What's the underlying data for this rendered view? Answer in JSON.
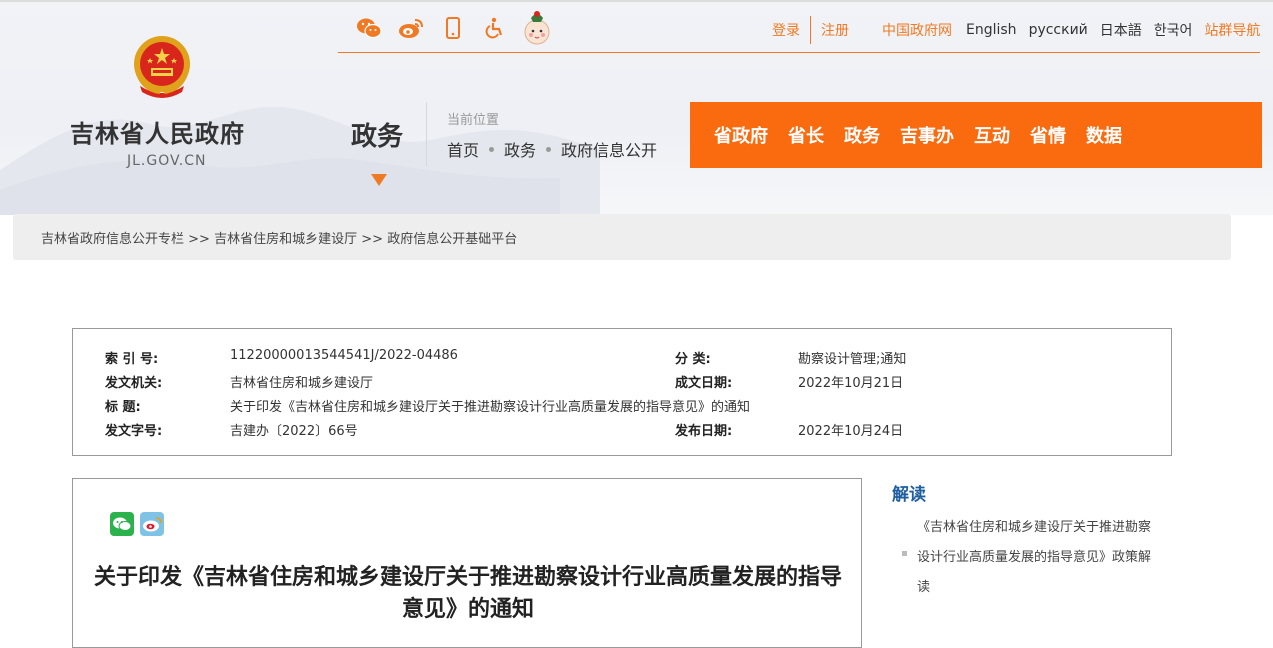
{
  "header": {
    "site_title": "吉林省人民政府",
    "site_domain": "JL.GOV.CN",
    "icons": [
      "wechat-icon",
      "weibo-icon",
      "mobile-icon",
      "accessibility-icon",
      "mascot-icon"
    ],
    "login": "登录",
    "register": "注册",
    "links": [
      "中国政府网",
      "English",
      "русский",
      "日本語",
      "한국어",
      "站群导航"
    ]
  },
  "section": {
    "label": "政务",
    "location_caption": "当前位置",
    "breadcrumb": [
      "首页",
      "政务",
      "政府信息公开"
    ]
  },
  "nav": {
    "items": [
      "省政府",
      "省长",
      "政务",
      "吉事办",
      "互动",
      "省情",
      "数据"
    ]
  },
  "strip": {
    "items": [
      "吉林省政府信息公开专栏",
      "吉林省住房和城乡建设厅",
      "政府信息公开基础平台"
    ],
    "separator": ">>"
  },
  "meta": {
    "index_label": "索 引 号:",
    "index_value": "11220000013544541J/2022-04486",
    "category_label": "分    类:",
    "category_value": "勘察设计管理;通知",
    "issuer_label": "发文机关:",
    "issuer_value": "吉林省住房和城乡建设厅",
    "date_made_label": "成文日期:",
    "date_made_value": "2022年10月21日",
    "title_label": "标    题:",
    "title_value": "关于印发《吉林省住房和城乡建设厅关于推进勘察设计行业高质量发展的指导意见》的通知",
    "doc_no_label": "发文字号:",
    "doc_no_value": "吉建办〔2022〕66号",
    "publish_label": "发布日期:",
    "publish_value": "2022年10月24日"
  },
  "article": {
    "title": "关于印发《吉林省住房和城乡建设厅关于推进勘察设计行业高质量发展的指导意见》的通知",
    "share_icons": [
      "wechat-share-icon",
      "weibo-share-icon"
    ]
  },
  "sidebar": {
    "heading": "解读",
    "link": "《吉林省住房和城乡建设厅关于推进勘察设计行业高质量发展的指导意见》政策解读"
  },
  "colors": {
    "accent": "#fa6a0f",
    "accent_text": "#f07a24",
    "sidebar_heading": "#1f5fa0"
  }
}
